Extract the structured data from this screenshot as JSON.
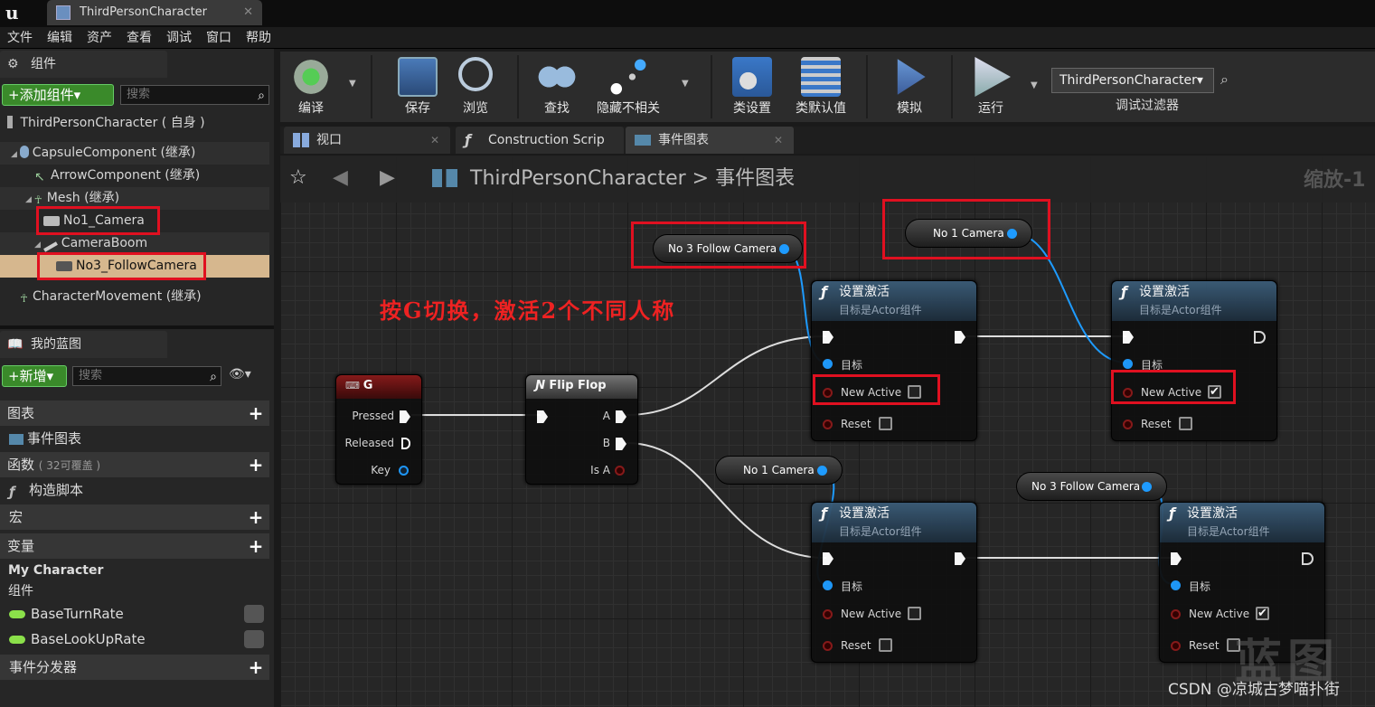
{
  "window": {
    "tab_title": "ThirdPersonCharacter",
    "close": "✕"
  },
  "menu": [
    "文件",
    "编辑",
    "资产",
    "查看",
    "调试",
    "窗口",
    "帮助"
  ],
  "components": {
    "panel_title": "组件",
    "add_button": "+添加组件▾",
    "search_placeholder": "搜索",
    "root": "ThirdPersonCharacter ( 自身 )",
    "tree": [
      "CapsuleComponent (继承)",
      "ArrowComponent (继承)",
      "Mesh (继承)",
      "No1_Camera",
      "CameraBoom",
      "No3_FollowCamera",
      "CharacterMovement (继承)"
    ]
  },
  "blueprint": {
    "panel_title": "我的蓝图",
    "new_button": "+新增▾",
    "search_placeholder": "搜索",
    "sections": {
      "graphs": "图表",
      "event_graph": "事件图表",
      "functions": "函数",
      "functions_count": "( 32可覆盖 )",
      "construction_script": "构造脚本",
      "macros": "宏",
      "variables": "变量",
      "my_character": "My Character",
      "components": "组件",
      "event_dispatchers": "事件分发器"
    },
    "variables": [
      "BaseTurnRate",
      "BaseLookUpRate"
    ]
  },
  "toolbar": {
    "compile": "编译",
    "save": "保存",
    "browse": "浏览",
    "find": "查找",
    "hide_unrelated": "隐藏不相关",
    "class_settings": "类设置",
    "class_defaults": "类默认值",
    "simulate": "模拟",
    "run": "运行",
    "debug_filter_value": "ThirdPersonCharacter▾",
    "debug_filter_label": "调试过滤器"
  },
  "doc_tabs": [
    "视口",
    "Construction Scrip",
    "事件图表"
  ],
  "graph": {
    "breadcrumb_root": "ThirdPersonCharacter",
    "breadcrumb_sep": ">",
    "breadcrumb_current": "事件图表",
    "zoom": "缩放-1",
    "annotation": "按G切换，激活2个不同人称",
    "nodes": {
      "key_g": {
        "title": "G",
        "pins": [
          "Pressed",
          "Released",
          "Key"
        ]
      },
      "flipflop": {
        "title": "Flip Flop",
        "pins": [
          "A",
          "B",
          "Is A"
        ]
      },
      "set_active": {
        "title": "设置激活",
        "subtitle": "目标是Actor组件",
        "target": "目标",
        "new_active": "New Active",
        "reset": "Reset"
      },
      "var_no3": "No 3 Follow Camera",
      "var_no1": "No 1 Camera"
    },
    "checkmark": "✔"
  },
  "watermark": {
    "csdn": "CSDN @凉城古梦喵扑街",
    "logo": "蓝图"
  }
}
